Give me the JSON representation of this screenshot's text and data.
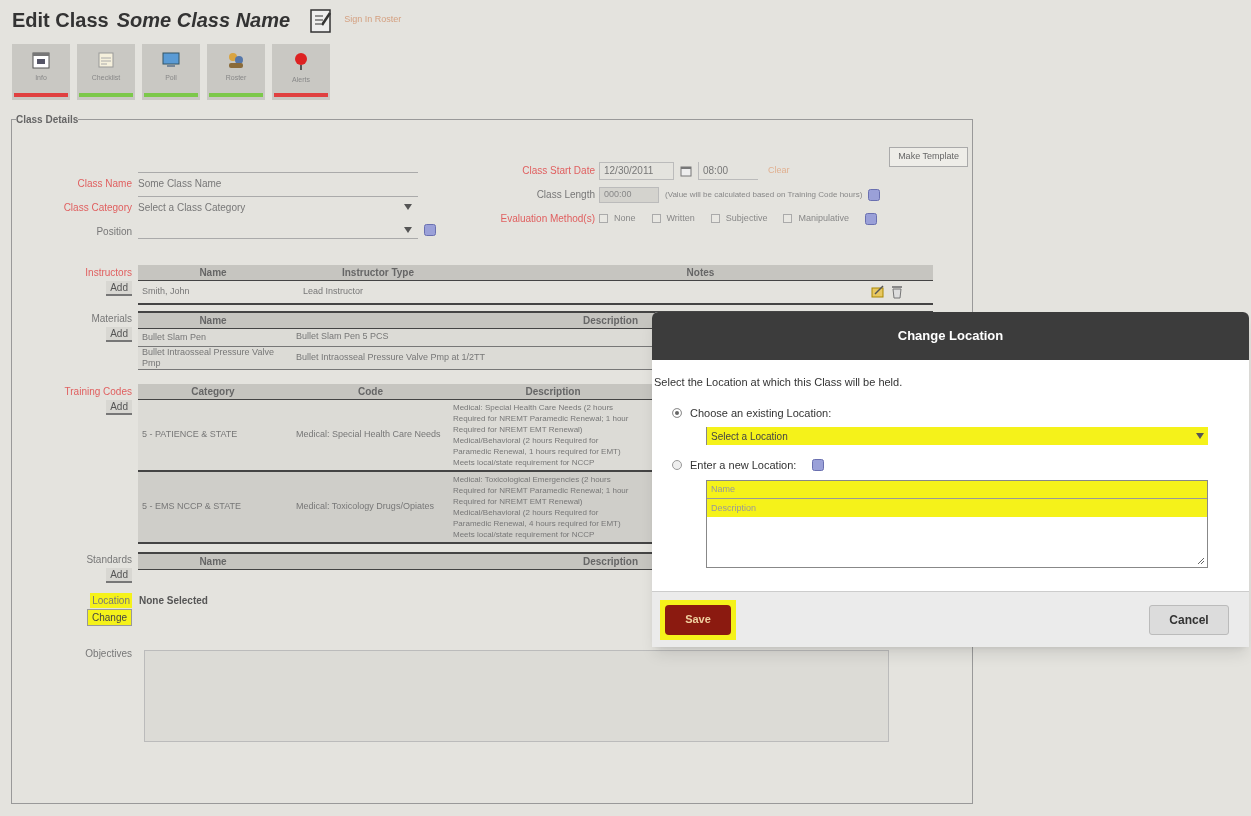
{
  "header": {
    "title": "Edit Class",
    "class_name": "Some Class Name",
    "roster_link": "Sign In Roster"
  },
  "toolbar": [
    {
      "label": "Info",
      "color": "#e04040",
      "kind": "calendar"
    },
    {
      "label": "Checklist",
      "color": "#7cc84a",
      "kind": "note"
    },
    {
      "label": "Poll",
      "color": "#7cc84a",
      "kind": "screen"
    },
    {
      "label": "Roster",
      "color": "#7cc84a",
      "kind": "people"
    },
    {
      "label": "Alerts",
      "color": "#e04040",
      "kind": "pin"
    }
  ],
  "details": {
    "legend": "Class Details",
    "make_template": "Make Template",
    "class_name": {
      "label": "Class Name",
      "value": "Some Class Name"
    },
    "class_category": {
      "label": "Class Category",
      "value": "Select a Class Category"
    },
    "position": {
      "label": "Position"
    },
    "start": {
      "label": "Class Start Date",
      "date": "12/30/2011",
      "time": "08:00",
      "clear": "Clear"
    },
    "length": {
      "label": "Class Length",
      "value": "000:00",
      "note": "(Value will be calculated based on Training Code hours)"
    },
    "evaluation": {
      "label": "Evaluation Method(s)",
      "options": [
        {
          "label": "None",
          "checked": false
        },
        {
          "label": "Written",
          "checked": false
        },
        {
          "label": "Subjective",
          "checked": false
        },
        {
          "label": "Manipulative",
          "checked": false
        }
      ]
    },
    "instructors": {
      "label": "Instructors",
      "add": "Add",
      "columns": [
        "Name",
        "Instructor Type",
        "Notes"
      ],
      "rows": [
        [
          "Smith, John",
          "Lead Instructor",
          ""
        ]
      ]
    },
    "materials": {
      "label": "Materials",
      "add": "Add",
      "columns": [
        "Name",
        "Description"
      ],
      "rows": [
        [
          "Bullet Slam Pen",
          "Bullet Slam Pen 5 PCS"
        ],
        [
          "Bullet Intraosseal Pressure Valve Pmp",
          "Bullet Intraosseal Pressure Valve Pmp at 1/2TT"
        ]
      ]
    },
    "training_codes": {
      "label": "Training Codes",
      "add": "Add",
      "columns": [
        "Category",
        "Code",
        "Description"
      ],
      "rows": [
        [
          "5 - PATIENCE & STATE",
          "Medical: Special Health Care Needs",
          "Medical: Special Health Care Needs (2 hours Required for NREMT Paramedic Renewal; 1 hour Required for NREMT EMT Renewal) Medical/Behavioral (2 hours Required for Paramedic Renewal, 1 hours required for EMT) Meets local/state requirement for NCCP"
        ],
        [
          "5 - EMS NCCP & STATE",
          "Medical: Toxicology Drugs/Opiates",
          "Medical: Toxicological Emergencies (2 hours Required for NREMT Paramedic Renewal; 1 hour Required for NREMT EMT Renewal) Medical/Behavioral (2 hours Required for Paramedic Renewal, 4 hours required for EMT) Meets local/state requirement for NCCP"
        ]
      ]
    },
    "standards": {
      "label": "Standards",
      "add": "Add",
      "columns": [
        "Name",
        "Description"
      ]
    },
    "location": {
      "label": "Location",
      "value": "None Selected",
      "change": "Change",
      "highlighted": true
    },
    "objectives": {
      "label": "Objectives"
    }
  },
  "dialog": {
    "title": "Change Location",
    "intro": "Select the Location at which this Class will be held.",
    "options": [
      {
        "label": "Choose an existing Location:",
        "selected": true
      },
      {
        "label": "Enter a new Location:",
        "selected": false
      }
    ],
    "select": {
      "value": "Select a Location",
      "highlighted": true
    },
    "name_field": {
      "placeholder": "Name",
      "highlighted": true
    },
    "description_field": {
      "placeholder": "Description",
      "highlighted": true
    },
    "save": {
      "label": "Save",
      "highlighted": true
    },
    "cancel": "Cancel"
  }
}
